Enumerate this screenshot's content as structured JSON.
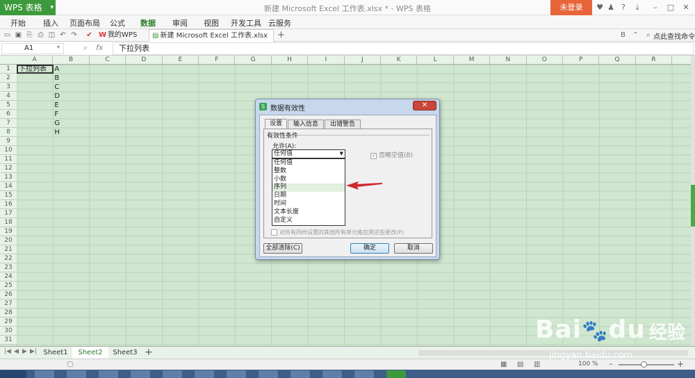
{
  "app": {
    "brand_button": "WPS 表格",
    "window_title": "新建 Microsoft Excel 工作表.xlsx * - WPS 表格",
    "login_button": "未登录"
  },
  "menu": [
    "开始",
    "插入",
    "页面布局",
    "公式",
    "数据",
    "审阅",
    "视图",
    "开发工具",
    "云服务"
  ],
  "active_menu_index": 4,
  "doc_tabs": [
    {
      "label": "我的WPS",
      "active": false
    },
    {
      "label": "新建 Microsoft Excel 工作表.xlsx *",
      "active": true
    }
  ],
  "toolbar_search": "点此查找命令",
  "formula_bar": {
    "cell_ref": "A1",
    "fx": "fx",
    "content": "下拉列表"
  },
  "columns": [
    "A",
    "B",
    "C",
    "D",
    "E",
    "F",
    "G",
    "H",
    "I",
    "J",
    "K",
    "L",
    "M",
    "N",
    "O",
    "P",
    "Q",
    "R"
  ],
  "rows": [
    "1",
    "2",
    "3",
    "4",
    "5",
    "6",
    "7",
    "8",
    "9",
    "10",
    "11",
    "12",
    "13",
    "14",
    "15",
    "16",
    "17",
    "18",
    "19",
    "20",
    "21",
    "22",
    "23",
    "24",
    "25",
    "26",
    "27",
    "28",
    "29",
    "30",
    "31"
  ],
  "cells": {
    "A1": "下拉列表",
    "B_column": [
      "A",
      "B",
      "C",
      "D",
      "E",
      "F",
      "G",
      "H"
    ]
  },
  "sheet_tabs": [
    "Sheet1",
    "Sheet2",
    "Sheet3"
  ],
  "active_sheet_index": 1,
  "status": {
    "zoom": "100 %"
  },
  "dialog": {
    "title": "数据有效性",
    "tabs": [
      "设置",
      "输入信息",
      "出错警告"
    ],
    "active_tab_index": 0,
    "criteria_label": "有效性条件",
    "allow_label": "允许(A):",
    "allow_selected": "任何值",
    "allow_options": [
      "任何值",
      "整数",
      "小数",
      "序列",
      "日期",
      "时间",
      "文本长度",
      "自定义"
    ],
    "highlighted_option_index": 3,
    "ignore_blank": "忽略空值(B)",
    "apply_all": "对所有同样设置的其他所有单元格应用这些更改(P)",
    "clear_all_button": "全部清除(C)",
    "ok_button": "确定",
    "cancel_button": "取消"
  },
  "watermark": {
    "brand": "Bai",
    "brand2": "du",
    "cn": "经验",
    "url": "jingyan.baidu.com"
  },
  "colors": {
    "sheet_bg": "#cfe6cf",
    "brand_green": "#3c9a3c",
    "login_orange": "#e8643a",
    "arrow_red": "#d0282e"
  }
}
